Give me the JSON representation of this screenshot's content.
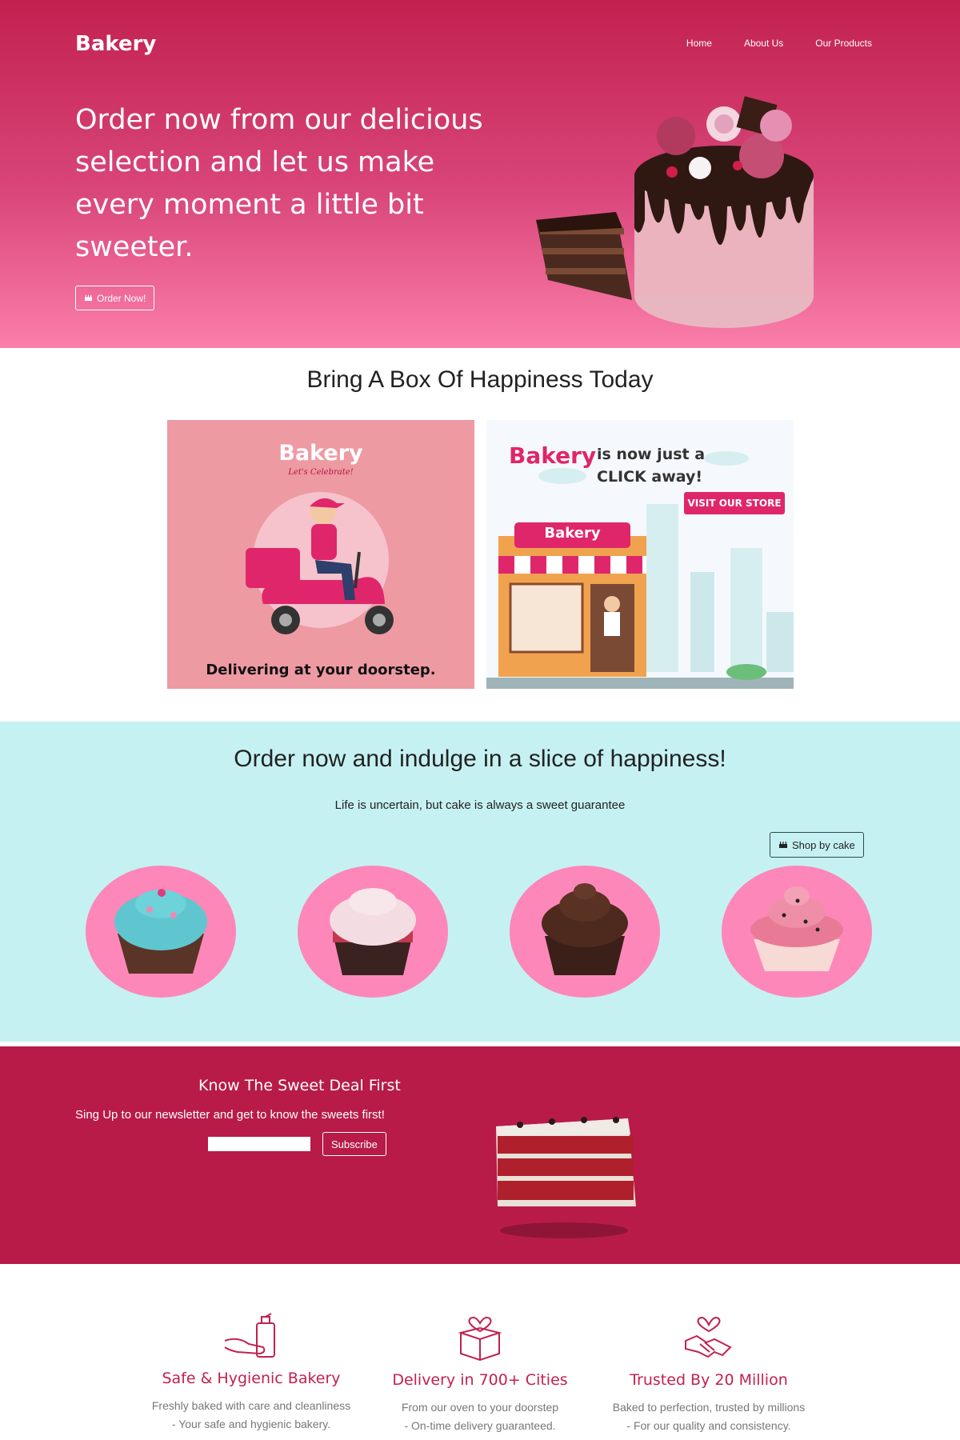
{
  "header": {
    "brand": "Bakery",
    "nav": [
      "Home",
      "About Us",
      "Our Products"
    ]
  },
  "hero": {
    "title": "Order now from our delicious selection and let us make every moment a little bit sweeter.",
    "button_label": "Order Now!",
    "button_icon": "birthday-cake-icon"
  },
  "happiness": {
    "title": "Bring A Box Of Happiness Today",
    "delivery_card": {
      "brand": "Bakery",
      "tagline": "Let's Celebrate!",
      "caption": "Delivering at your doorstep."
    },
    "store_card": {
      "brand": "Bakery",
      "headline_line1": "is now just a",
      "headline_line2": "CLICK away!",
      "cta": "VISIT OUR STORE",
      "shop_sign": "Bakery"
    }
  },
  "indulge": {
    "title": "Order now and indulge in a slice of happiness!",
    "subtitle": "Life is uncertain, but cake is always a sweet guarantee",
    "button_label": "Shop by cake",
    "button_icon": "birthday-cake-icon",
    "cupcakes": [
      "blue-frosted-cupcake",
      "white-frosted-red-velvet-cupcake",
      "chocolate-cupcake",
      "pink-frosted-cupcake"
    ]
  },
  "newsletter": {
    "title": "Know The Sweet Deal First",
    "subtitle": "Sing Up to our newsletter and get to know the sweets first!",
    "input_value": "",
    "button_label": "Subscribe"
  },
  "features": [
    {
      "icon": "hand-sanitizer-icon",
      "title": "Safe & Hygienic Bakery",
      "line1": "Freshly baked with care and cleanliness",
      "line2": "- Your safe and hygienic bakery."
    },
    {
      "icon": "gift-box-heart-icon",
      "title": "Delivery in 700+ Cities",
      "line1": "From our oven to your doorstep",
      "line2": "- On-time delivery guaranteed."
    },
    {
      "icon": "handshake-heart-icon",
      "title": "Trusted By 20 Million",
      "line1": "Baked to perfection, trusted by millions",
      "line2": "- For our quality and consistency."
    }
  ],
  "colors": {
    "primary": "#c2214f",
    "hero_bottom": "#fb7eaa",
    "mint": "#c6f1f2",
    "cupcake_circle": "#fd87b9",
    "newsletter_bg": "#b81b48"
  }
}
